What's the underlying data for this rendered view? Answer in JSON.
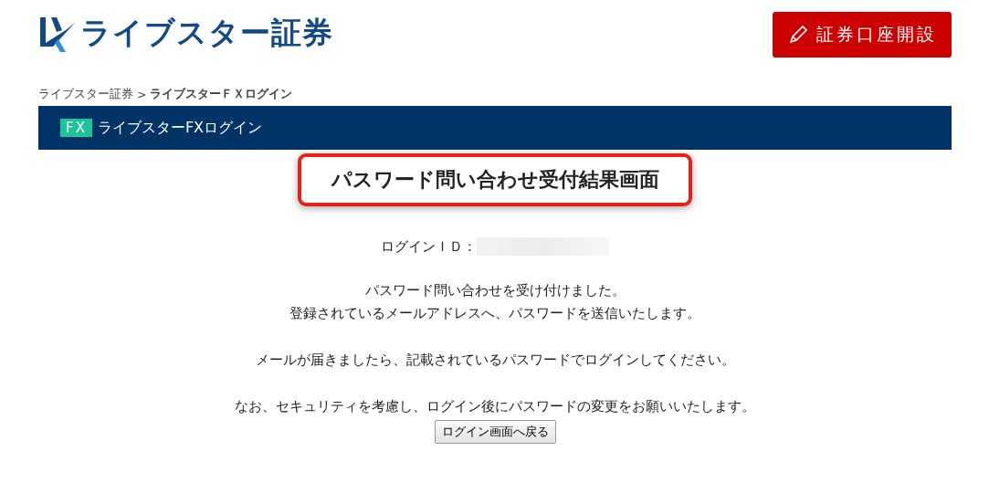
{
  "header": {
    "logo_text": "ライブスター証券",
    "open_account_button": "証券口座開設"
  },
  "breadcrumb": [
    {
      "label": "ライブスター証券",
      "current": false
    },
    {
      "label": "ライブスターＦＸログイン",
      "current": true
    }
  ],
  "breadcrumb_separator": ">",
  "section_bar": {
    "badge": "FX",
    "title": "ライブスターFXログイン"
  },
  "heading": "パスワード問い合わせ受付結果画面",
  "login_id_label": "ログインＩＤ：",
  "paragraphs": [
    [
      "パスワード問い合わせを受け付けました。",
      "登録されているメールアドレスへ、パスワードを送信いたします。"
    ],
    [
      "メールが届きましたら、記載されているパスワードでログインしてください。"
    ],
    [
      "なお、セキュリティを考慮し、ログイン後にパスワードの変更をお願いいたします。"
    ]
  ],
  "back_button": "ログイン画面へ戻る"
}
